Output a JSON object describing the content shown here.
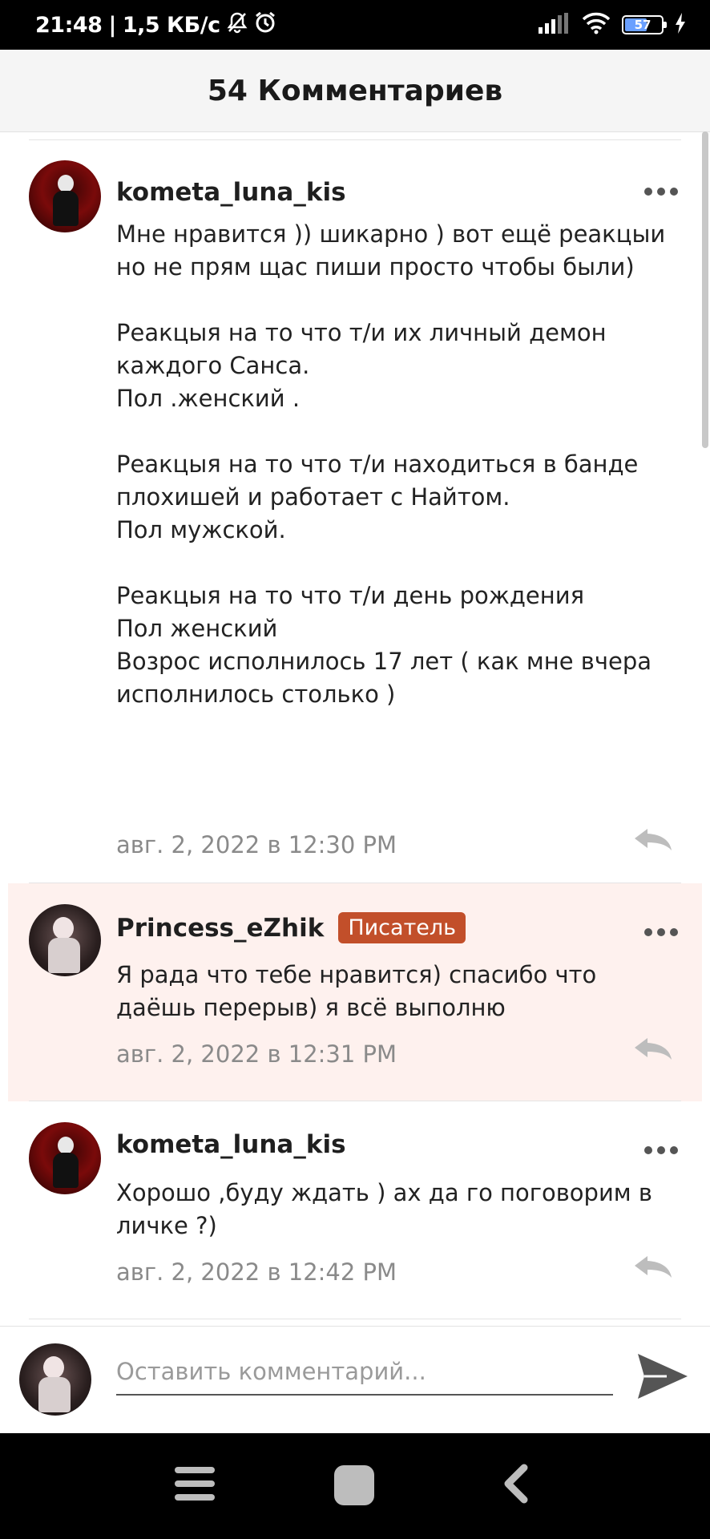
{
  "status_bar": {
    "time": "21:48",
    "speed": "1,5 КБ/с",
    "battery_level": "57",
    "icons": [
      "bell-off-icon",
      "alarm-icon",
      "signal-icon",
      "wifi-icon",
      "battery-icon",
      "charging-icon"
    ]
  },
  "header": {
    "title": "54 Комментариев"
  },
  "comments": [
    {
      "author": "kometa_luna_kis",
      "badge": "",
      "text": "Мне нравится )) шикарно ) вот ещё реакцыи\nно не прям щас пиши просто чтобы были)\n\nРеакцыя на то что т/и их личный демон\nкаждого Санса.\nПол .женский .\n\nРеакцыя на то что т/и находиться в банде\nплохишей и работает с Найтом.\nПол мужской.\n\nРеакцыя на то что т/и день рождения\nПол женский\nВозрос исполнилось 17 лет ( как мне вчера\nисполнилось столько )",
      "date": "авг. 2, 2022 в 12:30 PM"
    },
    {
      "author": "Princess_eZhik",
      "badge": "Писатель",
      "text": "Я рада что тебе нравится) спасибо что\nдаёшь перерыв) я всё выполню",
      "date": "авг. 2, 2022 в 12:31 PM"
    },
    {
      "author": "kometa_luna_kis",
      "badge": "",
      "text": "Хорошо ,буду ждать ) ах да го поговорим в\nличке ?)",
      "date": "авг. 2, 2022 в 12:42 PM"
    }
  ],
  "composer": {
    "placeholder": "Оставить комментарий..."
  },
  "colors": {
    "badge": "#c24f2a",
    "highlight_bg": "#fef1ee",
    "header_bg": "#f5f5f5"
  }
}
